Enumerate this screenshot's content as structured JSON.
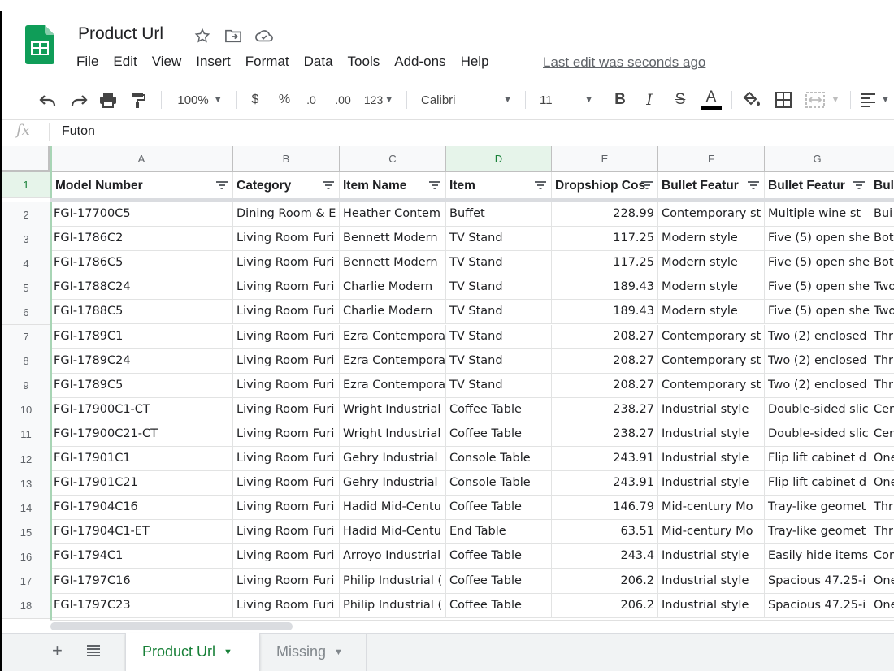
{
  "app": {
    "doc_title": "Product Url",
    "last_edit": "Last edit was seconds ago",
    "menu": [
      "File",
      "Edit",
      "View",
      "Insert",
      "Format",
      "Data",
      "Tools",
      "Add-ons",
      "Help"
    ]
  },
  "toolbar": {
    "zoom": "100%",
    "currency": "$",
    "percent": "%",
    "dec_decrease": ".0",
    "dec_increase": ".00",
    "more_formats": "123",
    "font": "Calibri",
    "font_size": "11",
    "bold": "B",
    "italic": "I",
    "strike": "S",
    "text_color": "A",
    "icons": [
      "undo-icon",
      "redo-icon",
      "print-icon",
      "paint-format-icon",
      "fill-color-icon",
      "borders-icon",
      "merge-icon",
      "align-icon"
    ]
  },
  "formula_bar": {
    "fx": "fx",
    "value": "Futon"
  },
  "grid": {
    "columns": [
      "A",
      "B",
      "C",
      "D",
      "E",
      "F",
      "G"
    ],
    "selected_column": "D",
    "selected_row": "1",
    "headers": [
      "Model Number",
      "Category",
      "Item Name",
      "Item",
      "Dropshiop Cos",
      "Bullet Featur",
      "Bullet Featur",
      "Bul"
    ],
    "rows": [
      {
        "n": "2",
        "a": "FGI-17700C5",
        "b": "Dining Room & E",
        "c": "Heather Contem",
        "d": "Buffet",
        "e": "228.99",
        "f": "Contemporary st",
        "g": "Multiple wine st",
        "h": "Bui"
      },
      {
        "n": "3",
        "a": "FGI-1786C2",
        "b": "Living Room Furi",
        "c": "Bennett Modern",
        "d": "TV Stand",
        "e": "117.25",
        "f": "Modern style",
        "g": "Five (5) open she",
        "h": "Bot"
      },
      {
        "n": "4",
        "a": "FGI-1786C5",
        "b": "Living Room Furi",
        "c": "Bennett Modern",
        "d": "TV Stand",
        "e": "117.25",
        "f": "Modern style",
        "g": "Five (5) open she",
        "h": "Bot"
      },
      {
        "n": "5",
        "a": "FGI-1788C24",
        "b": "Living Room Furi",
        "c": "Charlie Modern",
        "d": "TV Stand",
        "e": "189.43",
        "f": "Modern style",
        "g": "Five (5) open she",
        "h": "Two"
      },
      {
        "n": "6",
        "a": "FGI-1788C5",
        "b": "Living Room Furi",
        "c": "Charlie Modern",
        "d": "TV Stand",
        "e": "189.43",
        "f": "Modern style",
        "g": "Five (5) open she",
        "h": "Two"
      },
      {
        "n": "7",
        "a": "FGI-1789C1",
        "b": "Living Room Furi",
        "c": "Ezra Contempora",
        "d": "TV Stand",
        "e": "208.27",
        "f": "Contemporary st",
        "g": "Two (2) enclosed",
        "h": "Thr"
      },
      {
        "n": "8",
        "a": "FGI-1789C24",
        "b": "Living Room Furi",
        "c": "Ezra Contempora",
        "d": "TV Stand",
        "e": "208.27",
        "f": "Contemporary st",
        "g": "Two (2) enclosed",
        "h": "Thr"
      },
      {
        "n": "9",
        "a": "FGI-1789C5",
        "b": "Living Room Furi",
        "c": "Ezra Contempora",
        "d": "TV Stand",
        "e": "208.27",
        "f": "Contemporary st",
        "g": "Two (2) enclosed",
        "h": "Thr"
      },
      {
        "n": "10",
        "a": "FGI-17900C1-CT",
        "b": "Living Room Furi",
        "c": "Wright Industrial",
        "d": "Coffee Table",
        "e": "238.27",
        "f": "Industrial style",
        "g": "Double-sided slic",
        "h": "Cer"
      },
      {
        "n": "11",
        "a": "FGI-17900C21-CT",
        "b": "Living Room Furi",
        "c": "Wright Industrial",
        "d": "Coffee Table",
        "e": "238.27",
        "f": "Industrial style",
        "g": "Double-sided slic",
        "h": "Cer"
      },
      {
        "n": "12",
        "a": "FGI-17901C1",
        "b": "Living Room Furi",
        "c": "Gehry Industrial",
        "d": "Console Table",
        "e": "243.91",
        "f": "Industrial style",
        "g": "Flip lift cabinet d",
        "h": "One"
      },
      {
        "n": "13",
        "a": "FGI-17901C21",
        "b": "Living Room Furi",
        "c": "Gehry Industrial",
        "d": "Console Table",
        "e": "243.91",
        "f": "Industrial style",
        "g": "Flip lift cabinet d",
        "h": "One"
      },
      {
        "n": "14",
        "a": "FGI-17904C16",
        "b": "Living Room Furi",
        "c": "Hadid Mid-Centu",
        "d": "Coffee Table",
        "e": "146.79",
        "f": "Mid-century Mo",
        "g": "Tray-like geomet",
        "h": "Thr"
      },
      {
        "n": "15",
        "a": "FGI-17904C1-ET",
        "b": "Living Room Furi",
        "c": "Hadid Mid-Centu",
        "d": "End Table",
        "e": "63.51",
        "f": "Mid-century Mo",
        "g": "Tray-like geomet",
        "h": "Thr"
      },
      {
        "n": "16",
        "a": "FGI-1794C1",
        "b": "Living Room Furi",
        "c": "Arroyo Industrial",
        "d": "Coffee Table",
        "e": "243.4",
        "f": "Industrial style",
        "g": "Easily hide items",
        "h": "Cor"
      },
      {
        "n": "17",
        "a": "FGI-1797C16",
        "b": "Living Room Furi",
        "c": "Philip Industrial (",
        "d": "Coffee Table",
        "e": "206.2",
        "f": "Industrial style",
        "g": "Spacious 47.25-i",
        "h": "One"
      },
      {
        "n": "18",
        "a": "FGI-1797C23",
        "b": "Living Room Furi",
        "c": "Philip Industrial (",
        "d": "Coffee Table",
        "e": "206.2",
        "f": "Industrial style",
        "g": "Spacious 47.25-i",
        "h": "One"
      }
    ]
  },
  "sheets": {
    "add": "+",
    "active": "Product Url",
    "inactive": "Missing"
  },
  "colors": {
    "accent_green": "#188038",
    "selected_header_bg": "#e6f4ea",
    "sheets_logo": "#0f9d58"
  }
}
